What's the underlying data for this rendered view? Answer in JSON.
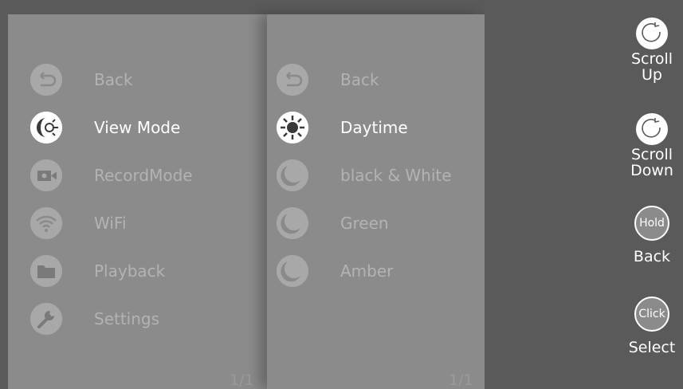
{
  "left_menu": {
    "items": [
      {
        "label": "Back",
        "icon": "back-arrow-icon",
        "selected": false
      },
      {
        "label": "View Mode",
        "icon": "view-mode-icon",
        "selected": true
      },
      {
        "label": "RecordMode",
        "icon": "video-camera-icon",
        "selected": false
      },
      {
        "label": "WiFi",
        "icon": "wifi-icon",
        "selected": false
      },
      {
        "label": "Playback",
        "icon": "folder-icon",
        "selected": false
      },
      {
        "label": "Settings",
        "icon": "wrench-icon",
        "selected": false
      }
    ],
    "page": "1/1"
  },
  "view_mode_menu": {
    "items": [
      {
        "label": "Back",
        "icon": "back-arrow-icon",
        "selected": false
      },
      {
        "label": "Daytime",
        "icon": "sun-icon",
        "selected": true
      },
      {
        "label": "black & White",
        "icon": "moon-icon",
        "selected": false
      },
      {
        "label": "Green",
        "icon": "moon-icon",
        "selected": false
      },
      {
        "label": "Amber",
        "icon": "moon-icon",
        "selected": false
      }
    ],
    "page": "1/1"
  },
  "controls": {
    "scroll_up": {
      "line1": "Scroll",
      "line2": "Up",
      "icon": "rotate-clockwise-icon"
    },
    "scroll_down": {
      "line1": "Scroll",
      "line2": "Down",
      "icon": "rotate-clockwise-icon"
    },
    "hold": {
      "badge": "Hold",
      "label": "Back"
    },
    "click": {
      "badge": "Click",
      "label": "Select"
    }
  },
  "colors": {
    "background": "#5a5a5a",
    "panel": "#8b8b8b",
    "selected_text": "#ffffff",
    "dim_text": "#b3b3b3",
    "icon_fill": "#a8a8a8"
  }
}
